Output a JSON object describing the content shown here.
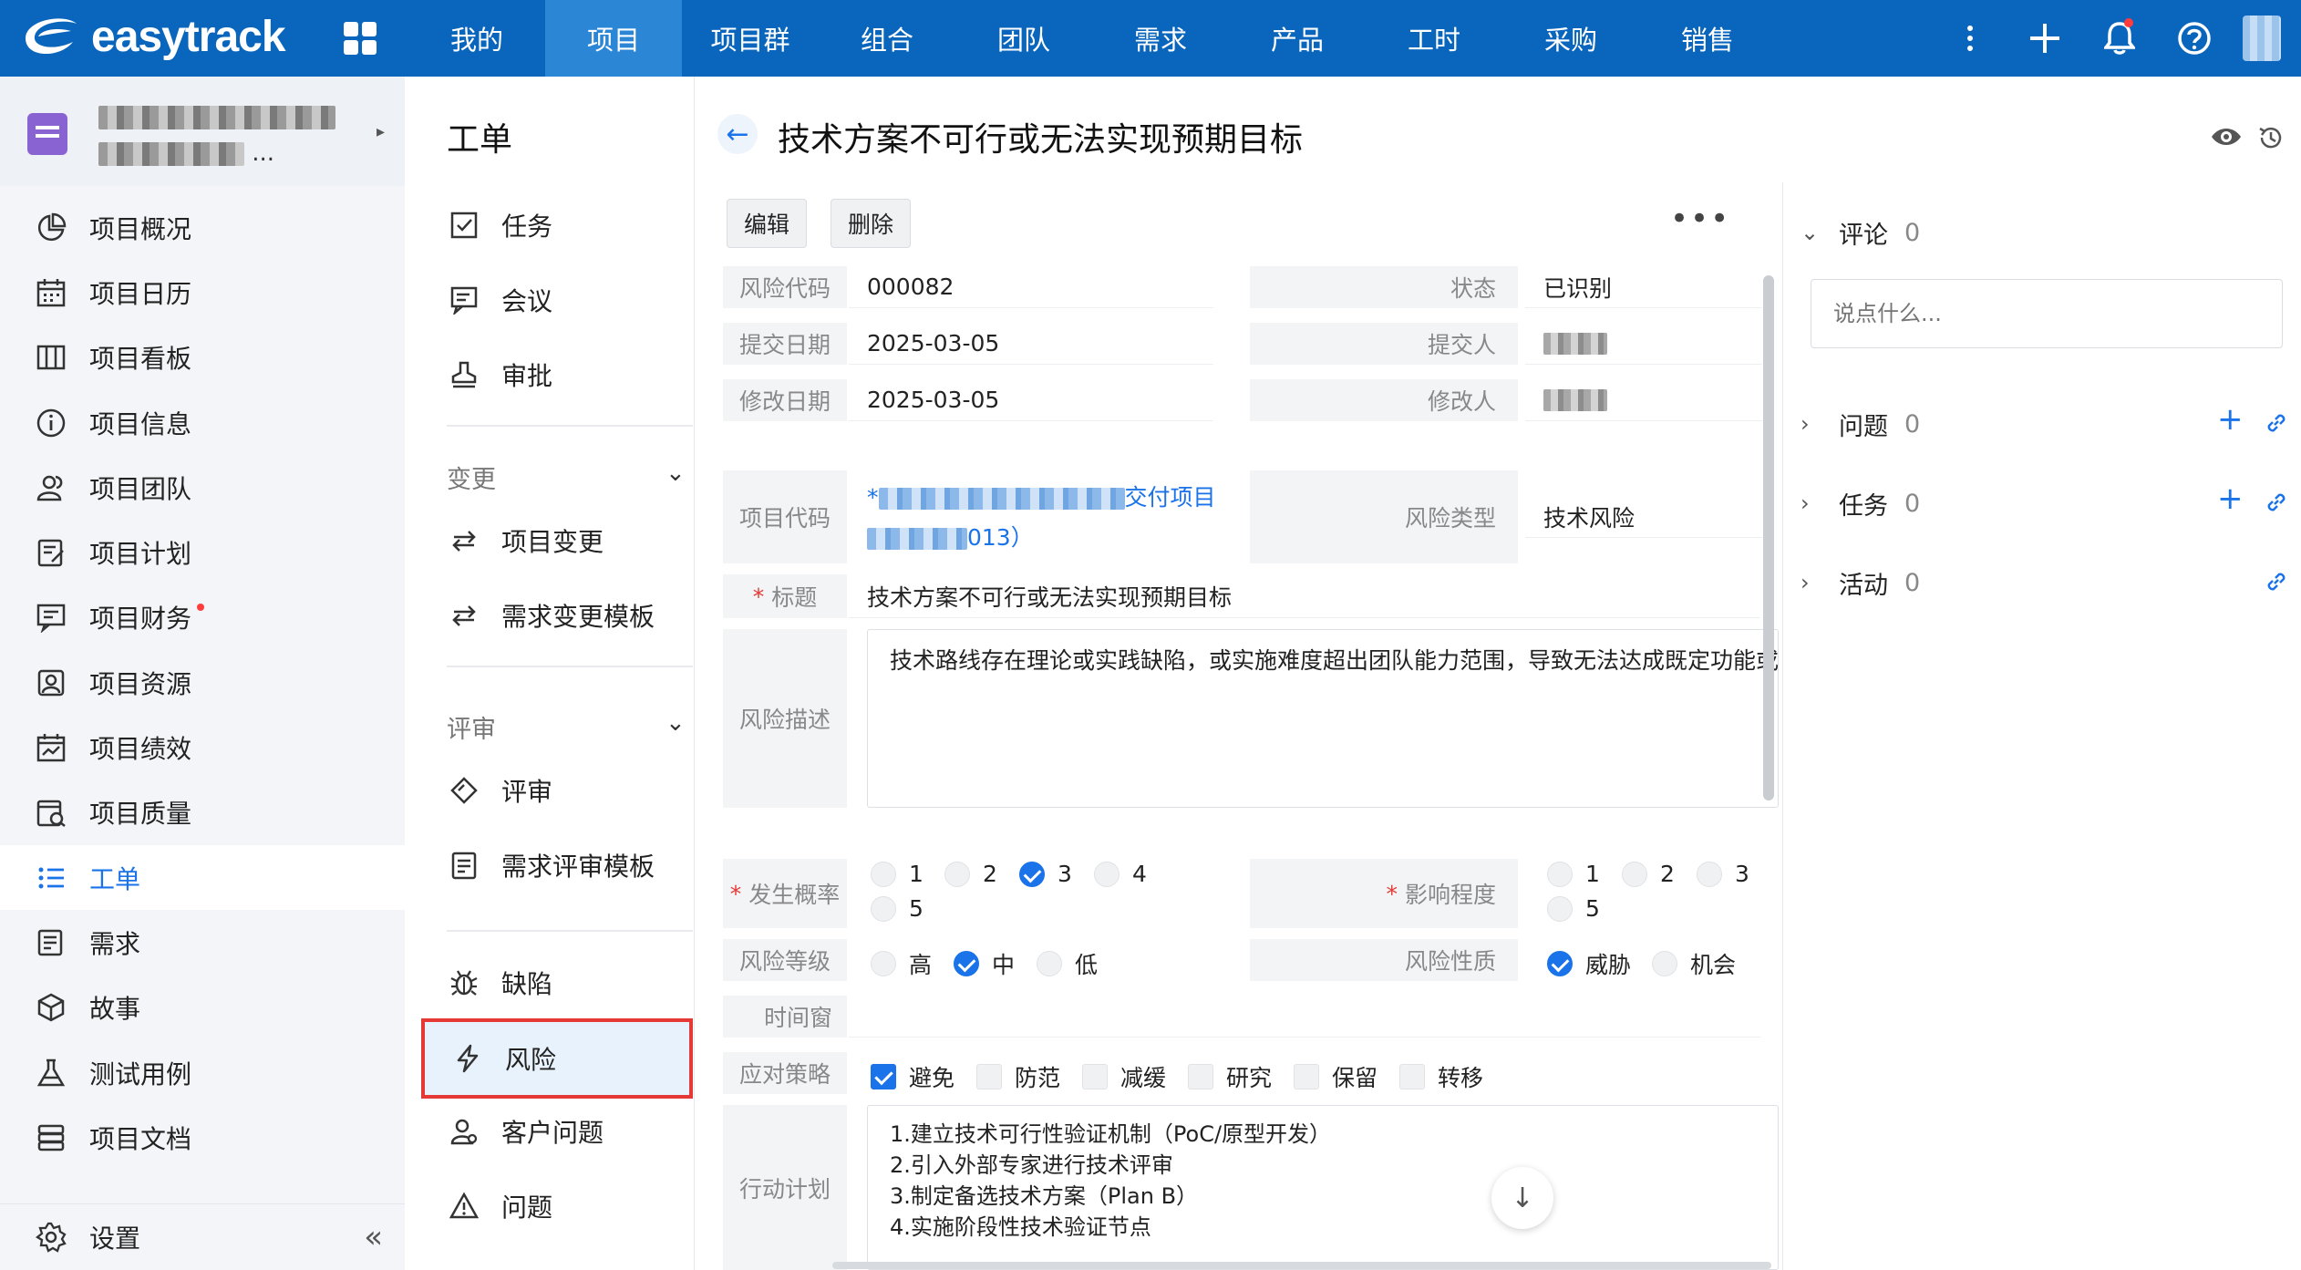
{
  "app": {
    "logo_text": "easytrack",
    "nav": [
      "我的",
      "项目",
      "项目群",
      "组合",
      "团队",
      "需求",
      "产品",
      "工时",
      "采购",
      "销售"
    ],
    "nav_active": 1
  },
  "sidebar": {
    "project_name_suffix": "...",
    "items": [
      {
        "label": "项目概况",
        "icon": "pie-chart-icon"
      },
      {
        "label": "项目日历",
        "icon": "calendar-icon"
      },
      {
        "label": "项目看板",
        "icon": "kanban-icon"
      },
      {
        "label": "项目信息",
        "icon": "info-icon"
      },
      {
        "label": "项目团队",
        "icon": "team-icon"
      },
      {
        "label": "项目计划",
        "icon": "plan-icon"
      },
      {
        "label": "项目财务",
        "icon": "finance-icon",
        "dot": true
      },
      {
        "label": "项目资源",
        "icon": "resource-icon"
      },
      {
        "label": "项目绩效",
        "icon": "performance-icon"
      },
      {
        "label": "项目质量",
        "icon": "quality-icon"
      },
      {
        "label": "工单",
        "icon": "list-icon",
        "active": true
      },
      {
        "label": "需求",
        "icon": "requirement-icon"
      },
      {
        "label": "故事",
        "icon": "story-icon"
      },
      {
        "label": "测试用例",
        "icon": "flask-icon"
      },
      {
        "label": "项目文档",
        "icon": "document-icon"
      }
    ],
    "settings_label": "设置"
  },
  "col2": {
    "title": "工单",
    "task": "任务",
    "meeting": "会议",
    "approval": "审批",
    "group_change": "变更",
    "project_change": "项目变更",
    "req_change_template": "需求变更模板",
    "group_review": "评审",
    "review": "评审",
    "req_review_template": "需求评审模板",
    "defect": "缺陷",
    "risk": "风险",
    "customer_issue": "客户问题",
    "issue": "问题"
  },
  "detail": {
    "title": "技术方案不可行或无法实现预期目标",
    "edit_label": "编辑",
    "delete_label": "删除",
    "more_label": "•••",
    "labels": {
      "risk_code": "风险代码",
      "status": "状态",
      "submit_date": "提交日期",
      "submitter": "提交人",
      "modify_date": "修改日期",
      "modifier": "修改人",
      "project_code": "项目代码",
      "risk_type": "风险类型",
      "title": "标题",
      "description": "风险描述",
      "probability": "发生概率",
      "impact": "影响程度",
      "risk_level": "风险等级",
      "risk_nature": "风险性质",
      "time_window": "时间窗",
      "strategy": "应对策略",
      "action_plan": "行动计划"
    },
    "values": {
      "risk_code": "000082",
      "status": "已识别",
      "submit_date": "2025-03-05",
      "modify_date": "2025-03-05",
      "project_code_prefix": "*",
      "project_code_mid": "交付项目",
      "project_code_end": "013）",
      "risk_type": "技术风险",
      "title": "技术方案不可行或无法实现预期目标",
      "description": "技术路线存在理论或实践缺陷，或实施难度超出团队能力范围，导致无法达成既定功能或性",
      "time_window": ""
    },
    "probability_options": [
      "1",
      "2",
      "3",
      "4",
      "5"
    ],
    "probability_selected": "3",
    "impact_options": [
      "1",
      "2",
      "3",
      "5"
    ],
    "level_options": [
      "高",
      "中",
      "低"
    ],
    "level_selected": "中",
    "nature_options": [
      "威胁",
      "机会"
    ],
    "nature_selected": "威胁",
    "strategy_options": [
      "避免",
      "防范",
      "减缓",
      "研究",
      "保留",
      "转移"
    ],
    "strategy_checked": [
      "避免"
    ],
    "action_plan": [
      "1.建立技术可行性验证机制（PoC/原型开发）",
      "2.引入外部专家进行技术评审",
      "3.制定备选技术方案（Plan B）",
      "4.实施阶段性技术验证节点"
    ]
  },
  "right_panel": {
    "comments_label": "评论",
    "comments_count": "0",
    "comment_placeholder": "说点什么...",
    "issues_label": "问题",
    "issues_count": "0",
    "tasks_label": "任务",
    "tasks_count": "0",
    "activities_label": "活动",
    "activities_count": "0"
  }
}
